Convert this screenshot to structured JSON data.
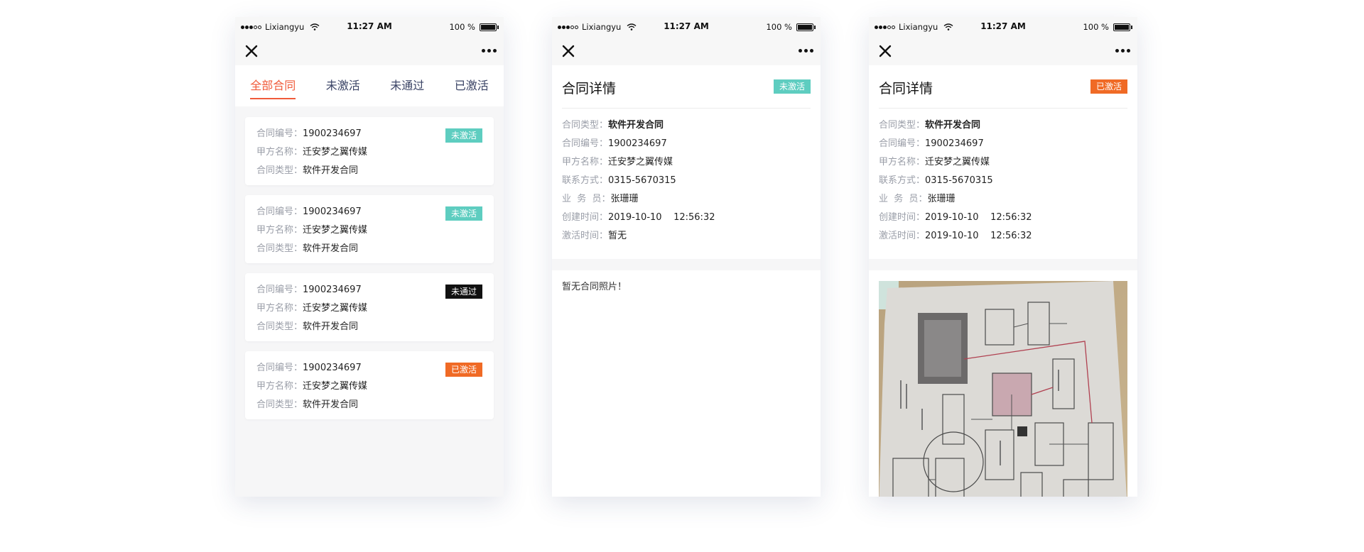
{
  "status": {
    "carrier": "Lixiangyu",
    "time": "11:27 AM",
    "battery": "100 %"
  },
  "labels": {
    "contract_no": "合同编号：",
    "party_a": "甲方名称：",
    "contract_type": "合同类型：",
    "contact": "联系方式：",
    "salesperson": "业  务  员：",
    "created": "创建时间：",
    "activated": "激活时间："
  },
  "list_screen": {
    "tabs": [
      {
        "label": "全部合同",
        "active": true
      },
      {
        "label": "未激活",
        "active": false
      },
      {
        "label": "未通过",
        "active": false
      },
      {
        "label": "已激活",
        "active": false
      }
    ],
    "cards": [
      {
        "contract_no": "1900234697",
        "party_a": "迁安梦之翼传媒",
        "contract_type": "软件开发合同",
        "status": "未激活",
        "status_color": "#5ecdc0"
      },
      {
        "contract_no": "1900234697",
        "party_a": "迁安梦之翼传媒",
        "contract_type": "软件开发合同",
        "status": "未激活",
        "status_color": "#5ecdc0"
      },
      {
        "contract_no": "1900234697",
        "party_a": "迁安梦之翼传媒",
        "contract_type": "软件开发合同",
        "status": "未通过",
        "status_color": "#111111"
      },
      {
        "contract_no": "1900234697",
        "party_a": "迁安梦之翼传媒",
        "contract_type": "软件开发合同",
        "status": "已激活",
        "status_color": "#f06a25"
      }
    ]
  },
  "detail_inactive": {
    "title": "合同详情",
    "status": "未激活",
    "contract_type": "软件开发合同",
    "contract_no": "1900234697",
    "party_a": "迁安梦之翼传媒",
    "contact": "0315-5670315",
    "salesperson": "张珊珊",
    "created": "2019-10-10    12:56:32",
    "activated": "暂无",
    "photo_text": "暂无合同照片！"
  },
  "detail_active": {
    "title": "合同详情",
    "status": "已激活",
    "contract_type": "软件开发合同",
    "contract_no": "1900234697",
    "party_a": "迁安梦之翼传媒",
    "contact": "0315-5670315",
    "salesperson": "张珊珊",
    "created": "2019-10-10    12:56:32",
    "activated": "2019-10-10    12:56:32"
  },
  "colors": {
    "accent": "#f05a3a",
    "inactive": "#5ecdc0",
    "failed": "#111111",
    "active": "#f06a25"
  }
}
